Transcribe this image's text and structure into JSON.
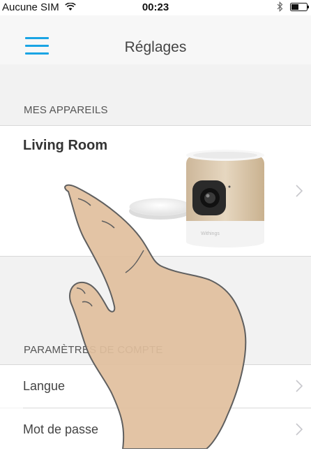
{
  "status_bar": {
    "carrier": "Aucune SIM",
    "time": "00:23",
    "wifi_icon": "wifi-icon",
    "bluetooth_icon": "bluetooth-icon",
    "battery_icon": "battery-icon"
  },
  "nav": {
    "title": "Réglages",
    "menu_icon": "hamburger-menu-icon"
  },
  "devices_section": {
    "header": "MES APPAREILS",
    "devices": [
      {
        "name": "Living Room",
        "image": "withings-home-camera",
        "chevron_icon": "chevron-right-icon"
      }
    ]
  },
  "account_section": {
    "header": "PARAMÈTRES DE COMPTE",
    "rows": [
      {
        "label": "Langue",
        "chevron_icon": "chevron-right-icon"
      },
      {
        "label": "Mot de passe",
        "chevron_icon": "chevron-right-icon"
      }
    ]
  },
  "colors": {
    "accent": "#1aa4e4",
    "background": "#f2f2f2",
    "card": "#ffffff",
    "divider": "#d8d8d8"
  }
}
